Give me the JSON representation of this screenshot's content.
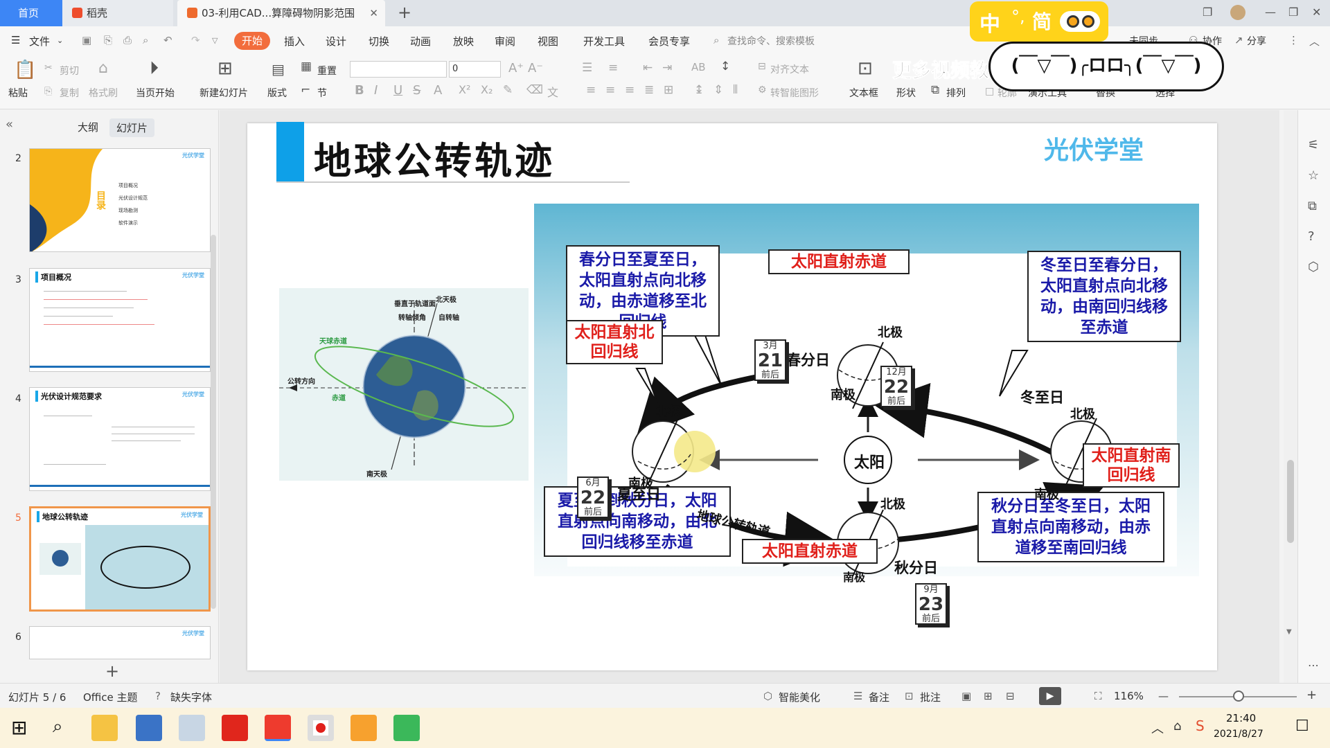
{
  "tabs": {
    "home": "首页",
    "daoke": "稻壳",
    "doc": "03-利用CAD...算障碍物阴影范围"
  },
  "menu": {
    "file": "文件",
    "items": [
      "开始",
      "插入",
      "设计",
      "切换",
      "动画",
      "放映",
      "审阅",
      "视图",
      "开发工具",
      "会员专享"
    ],
    "search_placeholder": "查找命令、搜索模板",
    "sync": "未同步",
    "collab": "协作",
    "share": "分享"
  },
  "toolbar": {
    "paste": "粘贴",
    "cut": "剪切",
    "copy": "复制",
    "format_painter": "格式刷",
    "from_current": "当页开始",
    "new_slide": "新建幻灯片",
    "layout": "版式",
    "reset": "重置",
    "section": "节",
    "font_size": "0",
    "align_text": "对齐文本",
    "smart_shape": "转智能图形",
    "textbox": "文本框",
    "shape": "形状",
    "arrange": "排列",
    "outline": "轮廓",
    "presentation_tools": "演示工具",
    "replace": "替换",
    "select": "选择"
  },
  "ime": {
    "lang": "中",
    "mode": "简",
    "emoticon": "(￣▽￣)╭ロロ╮(￣▽￣)",
    "overlay_text": "更多视频教"
  },
  "panel": {
    "outline_tab": "大纲",
    "slides_tab": "幻灯片",
    "add": "+"
  },
  "thumbnails": [
    {
      "num": "2",
      "title": "目录",
      "logo": "光伏学堂",
      "items": [
        "项目概况",
        "光伏设计规范",
        "现场勘测",
        "软件演示"
      ]
    },
    {
      "num": "3",
      "title": "项目概况",
      "logo": "光伏学堂"
    },
    {
      "num": "4",
      "title": "光伏设计规范要求",
      "logo": "光伏学堂"
    },
    {
      "num": "5",
      "title": "地球公转轨迹",
      "logo": "光伏学堂"
    },
    {
      "num": "6",
      "title": "",
      "logo": "光伏学堂"
    }
  ],
  "slide": {
    "title": "地球公转轨迹",
    "logo": "光伏学堂",
    "globe_labels": {
      "north": "北天极",
      "south": "南天极",
      "perp": "垂直于轨道面",
      "tilt": "转轴倾角",
      "axis": "自转轴",
      "celestial_eq": "天球赤道",
      "equator": "赤道",
      "orbit_dir": "公转方向"
    },
    "diagram": {
      "box_spring_summer": "春分日至夏至日，太阳直射点向北移动，由赤道移至北回归线",
      "box_sun_equator_top": "太阳直射赤道",
      "box_winter_spring": "冬至日至春分日，太阳直射点向北移动，由南回归线移至赤道",
      "box_sun_tropic_north": "太阳直射北回归线",
      "box_summer_autumn": "夏至日到秋分日，太阳直射点向南移动，由北回归线移至赤道",
      "box_sun_equator_bottom": "太阳直射赤道",
      "box_autumn_winter": "秋分日至冬至日，太阳直射点向南移动，由赤道移至南回归线",
      "box_sun_tropic_south": "太阳直射南回归线",
      "spring_equinox": "春分日",
      "summer_solstice": "夏至日",
      "autumn_equinox": "秋分日",
      "winter_solstice": "冬至日",
      "north_pole": "北极",
      "south_pole": "南极",
      "sun": "太阳",
      "orbit_label": "地球公转轨道",
      "approx": "前后",
      "cal_spring": {
        "month": "3月",
        "day": "21"
      },
      "cal_summer": {
        "month": "6月",
        "day": "22"
      },
      "cal_autumn": {
        "month": "9月",
        "day": "23"
      },
      "cal_winter": {
        "month": "12月",
        "day": "22"
      }
    }
  },
  "status": {
    "slide_counter": "幻灯片 5 / 6",
    "theme": "Office 主题",
    "missing_font": "缺失字体",
    "beautify": "智能美化",
    "notes": "备注",
    "comment": "批注",
    "zoom": "116%"
  },
  "taskbar": {
    "time": "21:40",
    "date": "2021/8/27"
  }
}
